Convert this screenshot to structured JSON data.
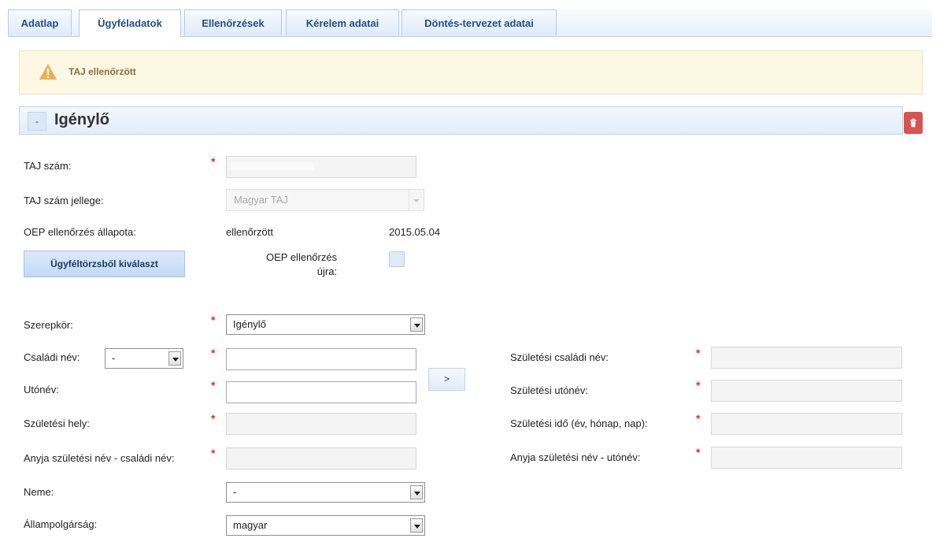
{
  "tabs": [
    "Adatlap",
    "Ügyféladatok",
    "Ellenőrzések",
    "Kérelem adatai",
    "Döntés-tervezet adatai"
  ],
  "alert": {
    "icon": "warning-icon",
    "text": "TAJ ellenőrzött"
  },
  "section": {
    "toggle": "-",
    "title": "Igénylő",
    "delete_icon": "trash-icon"
  },
  "labels": {
    "taj_szam": "TAJ szám:",
    "taj_jellege": "TAJ szám jellege:",
    "oep_allapot": "OEP ellenőrzés állapota:",
    "szerepkor": "Szerepkör:",
    "csaladi_nev": "Családi név:",
    "utonev": "Utónév:",
    "szuletesi_hely": "Születési hely:",
    "anyja_csaladi": "Anyja születési név - családi név:",
    "neme": "Neme:",
    "allampolgarsag": "Állampolgárság:",
    "szul_csaladi": "Születési családi név:",
    "szul_utonev": "Születési utónév:",
    "szul_ido": "Születési idő (év, hónap, nap):",
    "anyja_utonev": "Anyja születési név - utónév:"
  },
  "required_mark": "*",
  "fields": {
    "taj_jellege_value": "Magyar TAJ",
    "oep_status": "ellenőrzött",
    "oep_date": "2015.05.04",
    "szerepkor_value": "Igénylő",
    "csaladi_nev_prefix": "-",
    "neme_value": "-",
    "allampolgarsag_value": "magyar"
  },
  "buttons": {
    "ugyfeltorzs": "Ügyféltörzsből kiválaszt",
    "copy": ">"
  },
  "oep_recheck_label": "OEP ellenőrzés újra:",
  "oep_recheck_label_line1": "OEP ellenőrzés",
  "oep_recheck_label_line2": "újra:"
}
